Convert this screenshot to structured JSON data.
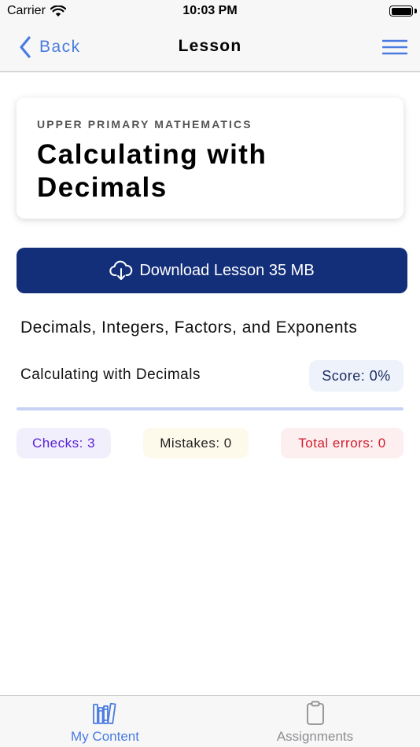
{
  "status_bar": {
    "carrier": "Carrier",
    "time": "10:03 PM"
  },
  "nav": {
    "back_label": "Back",
    "title": "Lesson"
  },
  "header": {
    "subtitle": "UPPER PRIMARY MATHEMATICS",
    "title": "Calculating with Decimals"
  },
  "download": {
    "label": "Download Lesson 35 MB"
  },
  "topic": {
    "title": "Decimals, Integers, Factors, and Exponents"
  },
  "lesson": {
    "name": "Calculating with Decimals",
    "score": "Score: 0%",
    "progress": 0
  },
  "stats": {
    "checks": "Checks: 3",
    "mistakes": "Mistakes: 0",
    "errors": "Total errors: 0"
  },
  "tabs": [
    {
      "label": "My Content",
      "icon": "books-icon",
      "active": true
    },
    {
      "label": "Assignments",
      "icon": "clipboard-icon",
      "active": false
    }
  ],
  "colors": {
    "accent": "#4a7be0",
    "download_button": "#142f7a",
    "checks": "#5a22d8",
    "errors": "#cf1e2e"
  }
}
